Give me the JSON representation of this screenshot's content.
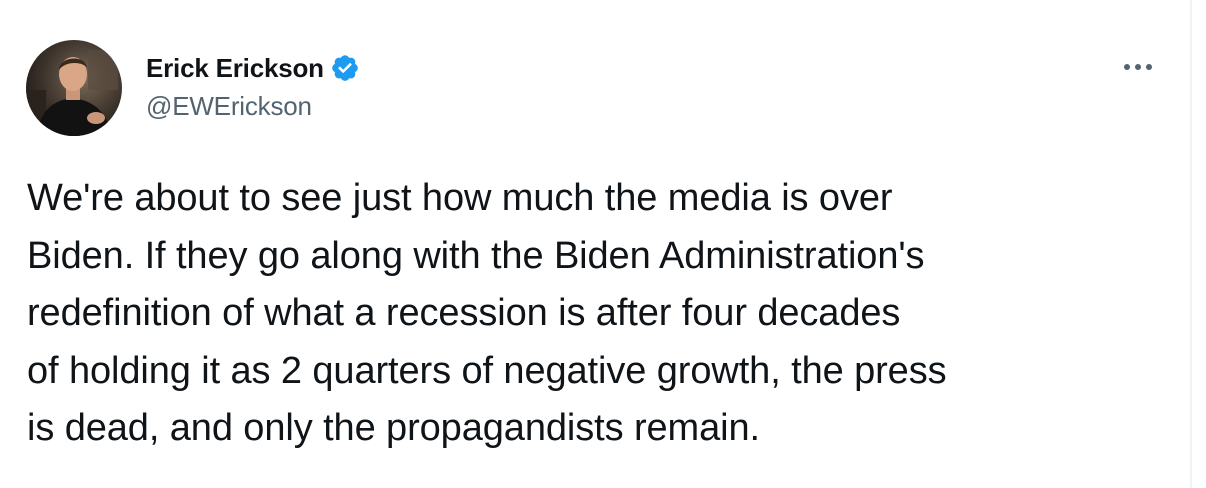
{
  "tweet": {
    "author": {
      "display_name": "Erick Erickson",
      "handle": "@EWErickson",
      "verified": true
    },
    "text": "We're about to see just how much the media is over\nBiden.  If they go along with the Biden Administration's\nredefinition of what a recession is after four decades\nof holding it as 2 quarters of negative growth, the press\nis dead, and only the propagandists remain.",
    "icons": {
      "verified": "verified-badge-icon",
      "more": "more-options-icon"
    }
  },
  "colors": {
    "verified_blue": "#1d9bf0",
    "text_primary": "#0f1419",
    "text_secondary": "#536471"
  }
}
